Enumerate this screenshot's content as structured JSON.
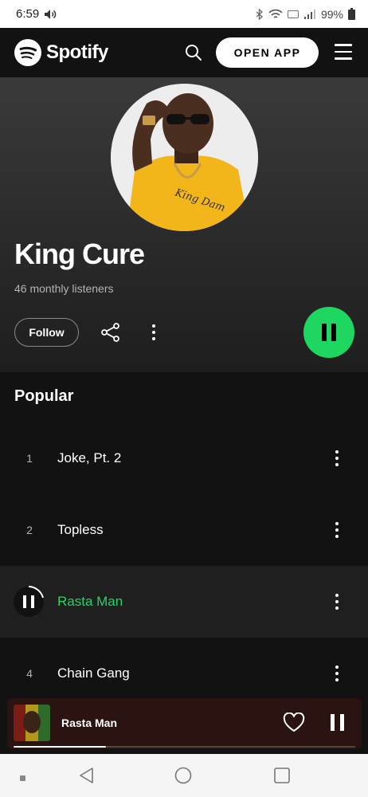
{
  "status_bar": {
    "time": "6:59",
    "battery": "99%"
  },
  "header": {
    "brand": "Spotify",
    "open_app_label": "OPEN APP"
  },
  "artist": {
    "name": "King Cure",
    "listeners": "46 monthly listeners",
    "follow_label": "Follow"
  },
  "popular": {
    "title": "Popular",
    "tracks": [
      {
        "number": "1",
        "title": "Joke, Pt. 2"
      },
      {
        "number": "2",
        "title": "Topless"
      },
      {
        "number": "3",
        "title": "Rasta Man"
      },
      {
        "number": "4",
        "title": "Chain Gang"
      }
    ]
  },
  "player": {
    "title": "Rasta Man",
    "progress": 0.27
  },
  "colors": {
    "accent": "#1ed760",
    "background": "#121212",
    "player_bg": "#2a1310"
  },
  "icons": {
    "search": "search-icon",
    "menu": "hamburger-menu-icon",
    "share": "share-icon",
    "more": "more-vertical-icon",
    "play_pause": "pause-icon",
    "heart": "heart-icon"
  }
}
